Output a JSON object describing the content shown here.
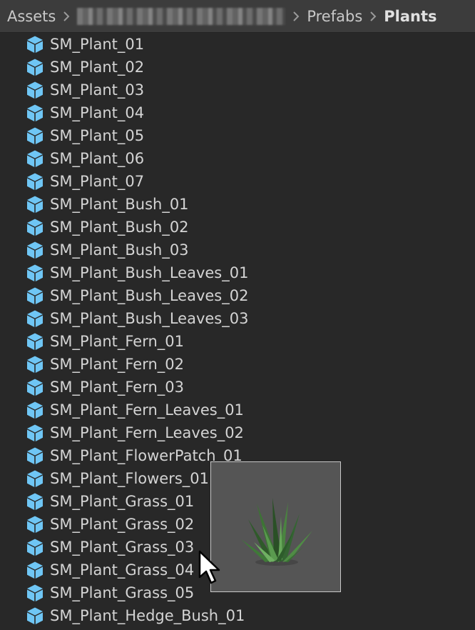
{
  "breadcrumb": {
    "root": "Assets",
    "level2": "Prefabs",
    "current": "Plants"
  },
  "colors": {
    "icon": "#6fc6f5",
    "background": "#282828",
    "header": "#3c3c3c",
    "preview_bg": "#555555"
  },
  "icon_name": "prefab-cube-icon",
  "items": [
    "SM_Plant_01",
    "SM_Plant_02",
    "SM_Plant_03",
    "SM_Plant_04",
    "SM_Plant_05",
    "SM_Plant_06",
    "SM_Plant_07",
    "SM_Plant_Bush_01",
    "SM_Plant_Bush_02",
    "SM_Plant_Bush_03",
    "SM_Plant_Bush_Leaves_01",
    "SM_Plant_Bush_Leaves_02",
    "SM_Plant_Bush_Leaves_03",
    "SM_Plant_Fern_01",
    "SM_Plant_Fern_02",
    "SM_Plant_Fern_03",
    "SM_Plant_Fern_Leaves_01",
    "SM_Plant_Fern_Leaves_02",
    "SM_Plant_FlowerPatch_01",
    "SM_Plant_Flowers_01",
    "SM_Plant_Grass_01",
    "SM_Plant_Grass_02",
    "SM_Plant_Grass_03",
    "SM_Plant_Grass_04",
    "SM_Plant_Grass_05",
    "SM_Plant_Hedge_Bush_01"
  ]
}
